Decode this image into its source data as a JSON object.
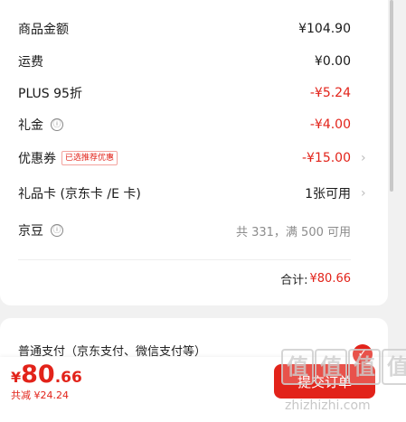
{
  "summary": {
    "rows": [
      {
        "label": "商品金额",
        "value": "¥104.90"
      },
      {
        "label": "运费",
        "value": "¥0.00"
      },
      {
        "label": "PLUS 95折",
        "value": "-¥5.24"
      },
      {
        "label": "礼金",
        "value": "-¥4.00",
        "info_icon": "ⓘ"
      },
      {
        "label": "优惠券",
        "tag": "已选推荐优惠",
        "value": "-¥15.00",
        "chevron": "›"
      },
      {
        "label": "礼品卡 (京东卡 /E 卡)",
        "value": "1张可用",
        "chevron": "›"
      },
      {
        "label": "京豆",
        "value": "共 331，满 500 可用",
        "info_icon": "ⓘ"
      }
    ],
    "total_label": "合计:",
    "total_value": "¥80.66"
  },
  "payment": {
    "label": "普通支付（京东支付、微信支付等）"
  },
  "bottom_bar": {
    "currency": "¥",
    "price_int": "80",
    "price_dec": ".66",
    "saved": "共减 ¥24.24",
    "submit_label": "提交订单",
    "badge": "✓"
  },
  "watermark": {
    "chars": [
      "值",
      "值",
      "值",
      "值"
    ],
    "url": "zhizhizhi.com"
  },
  "colors": {
    "accent": "#e2231a",
    "background": "#f1f1f1",
    "card": "#ffffff"
  }
}
